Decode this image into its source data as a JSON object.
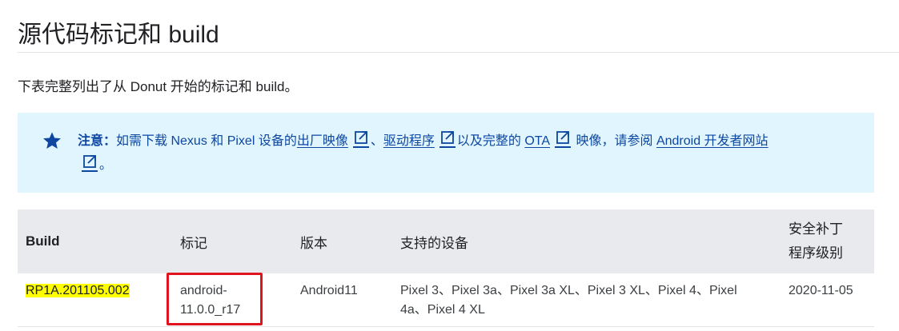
{
  "page": {
    "title": "源代码标记和 build",
    "intro": "下表完整列出了从 Donut 开始的标记和 build。"
  },
  "note": {
    "icon": "star-icon",
    "label": "注意：",
    "text_1": "如需下载 Nexus 和 Pixel 设备的",
    "link_1": "出厂映像",
    "sep_1": "、",
    "link_2": "驱动程序",
    "text_2": "以及完整的 ",
    "link_3": "OTA",
    "text_3": " 映像，请参阅 ",
    "link_4": "Android 开发者网站",
    "text_4": "。",
    "colors": {
      "background": "#e1f5fe",
      "text": "#0d47a1"
    }
  },
  "table": {
    "headers": [
      "Build",
      "标记",
      "版本",
      "支持的设备",
      "安全补丁程序级别"
    ],
    "header_lines": {
      "patch_1": "安全补丁",
      "patch_2": "程序级别"
    },
    "rows": [
      {
        "build": "RP1A.201105.002",
        "tag_1": "android-",
        "tag_2": "11.0.0_r17",
        "version": "Android11",
        "devices_1": "Pixel 3、Pixel 3a、Pixel 3a XL、Pixel 3 XL、Pixel 4、Pixel",
        "devices_2": "4a、Pixel 4 XL",
        "patch": "2020-11-05"
      }
    ]
  },
  "annotations": {
    "build_highlight_color": "#ffff00",
    "tag_box_color": "#e0141e"
  }
}
